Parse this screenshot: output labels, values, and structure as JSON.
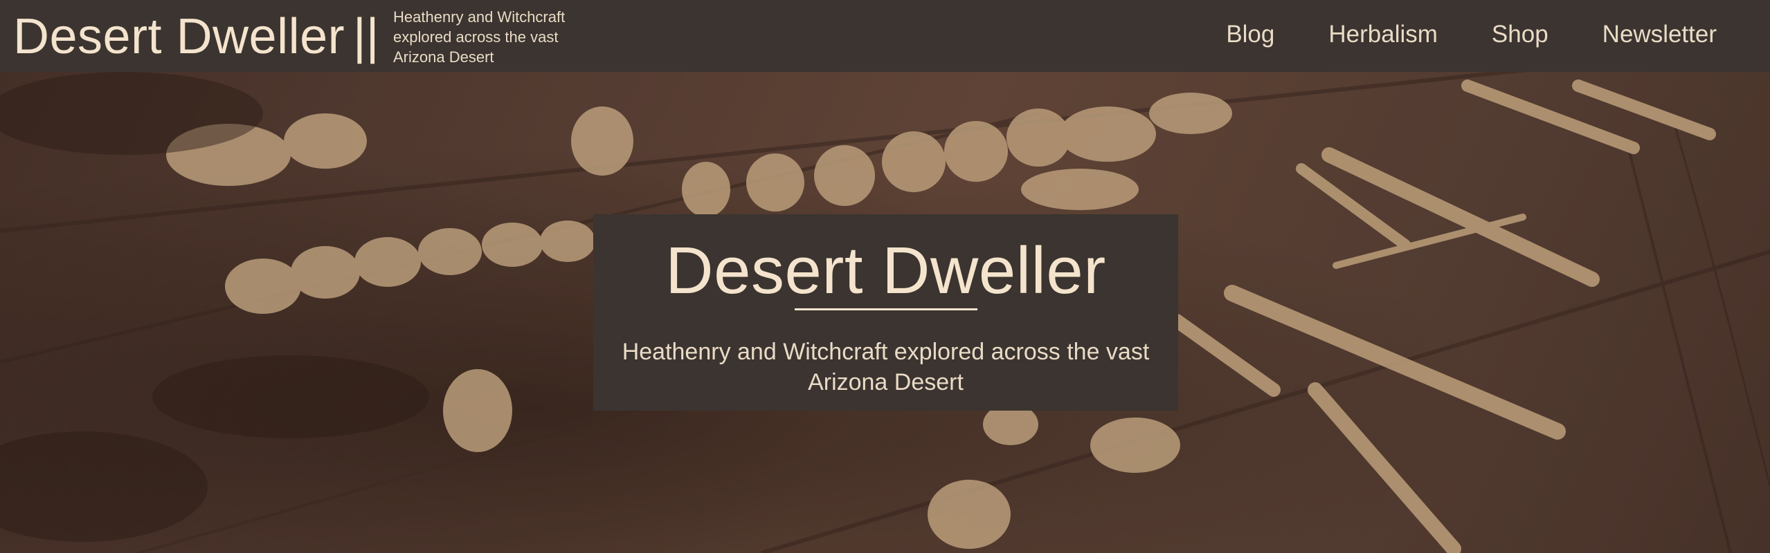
{
  "header": {
    "site_title": "Desert Dweller",
    "divider": "||",
    "tagline": "Heathenry and Witchcraft explored across the vast Arizona Desert"
  },
  "nav": {
    "items": [
      {
        "label": "Blog"
      },
      {
        "label": "Herbalism"
      },
      {
        "label": "Shop"
      },
      {
        "label": "Newsletter"
      }
    ]
  },
  "hero": {
    "title": "Desert Dweller",
    "subtitle": "Heathenry and Witchcraft explored across the vast Arizona Desert",
    "background_image": "bones-on-wood-image"
  },
  "colors": {
    "header_bg": "#3b3430",
    "text_cream": "#f5e4cd",
    "text_light": "#eadbc6"
  }
}
